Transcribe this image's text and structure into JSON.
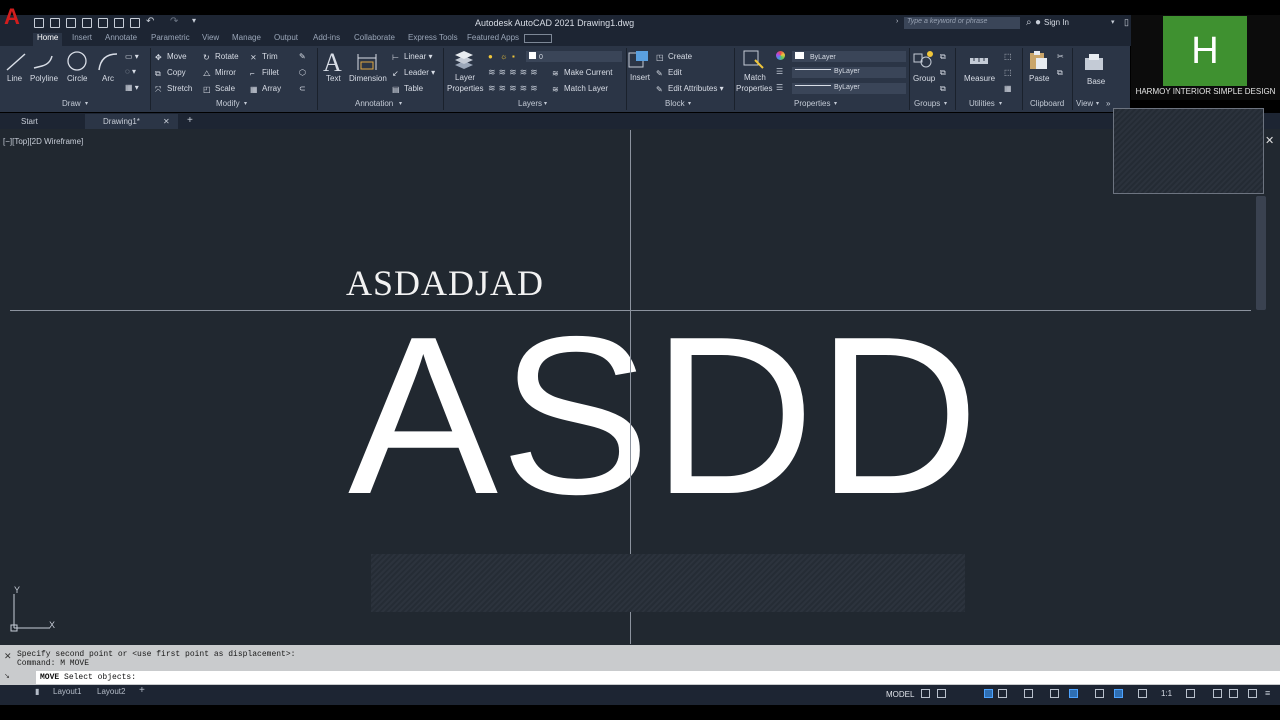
{
  "title_bar": {
    "title": "Autodesk AutoCAD 2021    Drawing1.dwg",
    "search_placeholder": "Type a keyword or phrase",
    "sign_in": "Sign In",
    "app_logo": "A"
  },
  "ribbon_tabs": [
    "Home",
    "Insert",
    "Annotate",
    "Parametric",
    "View",
    "Manage",
    "Output",
    "Add-ins",
    "Collaborate",
    "Express Tools",
    "Featured Apps"
  ],
  "panels": {
    "draw": {
      "title": "Draw",
      "line": "Line",
      "polyline": "Polyline",
      "circle": "Circle",
      "arc": "Arc"
    },
    "modify": {
      "title": "Modify",
      "move": "Move",
      "rotate": "Rotate",
      "trim": "Trim",
      "copy": "Copy",
      "mirror": "Mirror",
      "fillet": "Fillet",
      "stretch": "Stretch",
      "scale": "Scale",
      "array": "Array"
    },
    "annotation": {
      "title": "Annotation",
      "text": "Text",
      "dimension": "Dimension",
      "linear": "Linear",
      "leader": "Leader",
      "table": "Table"
    },
    "layers": {
      "title": "Layers",
      "layer_properties_1": "Layer",
      "layer_properties_2": "Properties",
      "current_layer": "0",
      "make_current": "Make Current",
      "match_layer": "Match Layer"
    },
    "block": {
      "title": "Block",
      "insert": "Insert",
      "create": "Create",
      "edit": "Edit",
      "edit_attributes": "Edit Attributes"
    },
    "properties": {
      "title": "Properties",
      "match_1": "Match",
      "match_2": "Properties",
      "color": "ByLayer",
      "lineweight": "ByLayer",
      "linetype": "ByLayer"
    },
    "groups": {
      "title": "Groups",
      "group": "Group"
    },
    "utilities": {
      "title": "Utilities",
      "measure": "Measure"
    },
    "clipboard": {
      "title": "Clipboard",
      "paste": "Paste"
    },
    "view": {
      "title": "View",
      "base": "Base"
    }
  },
  "channel_logo": {
    "letter": "H",
    "caption": "HARMOY INTERIOR SIMPLE DESIGN"
  },
  "doc_tabs": {
    "start": "Start",
    "drawing": "Drawing1*",
    "close": "✕",
    "new": "+"
  },
  "viewport": {
    "label": "[−][Top][2D Wireframe]",
    "small_text": "ASDADJAD",
    "big_text": "ASDD",
    "ucs_x": "X",
    "ucs_y": "Y",
    "close": "✕"
  },
  "command_line": {
    "history_1": "Specify second point or <use first point as displacement>:",
    "history_2": "Command: M MOVE",
    "input_command": "MOVE",
    "input_prompt": "Select objects:"
  },
  "status_bar": {
    "layout_tabs": [
      "Layout1",
      "Layout2"
    ],
    "add": "+",
    "model": "MODEL",
    "scale": "1:1"
  },
  "colors": {
    "canvas": "#212830",
    "ribbon": "#2b3546",
    "titlebar": "#1d2533",
    "logo_green": "#3f9130",
    "autocad_red": "#d11d1d"
  }
}
